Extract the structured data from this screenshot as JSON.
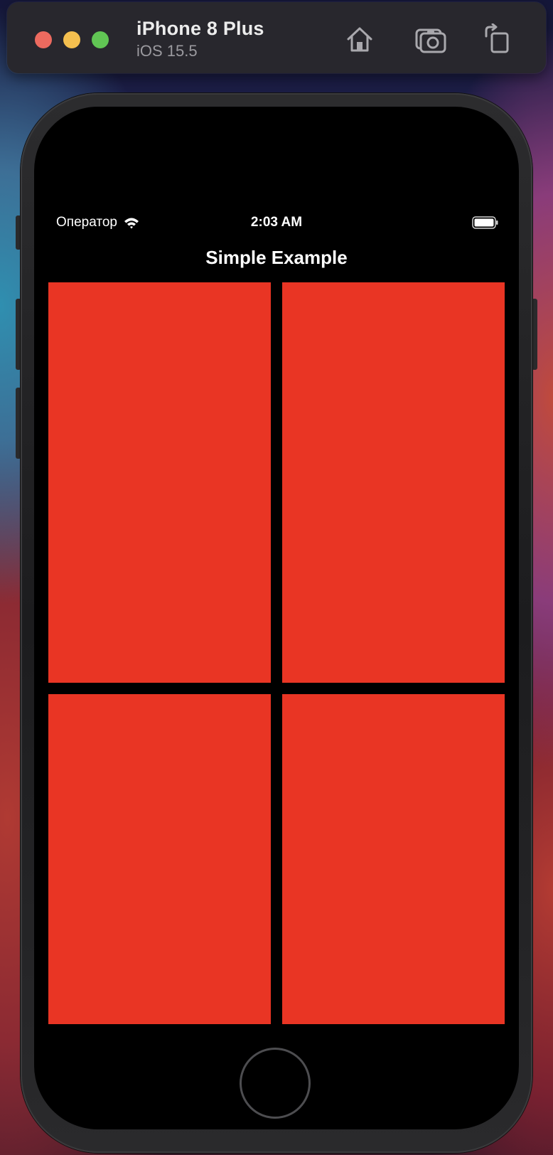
{
  "simulator": {
    "device_name": "iPhone 8 Plus",
    "os_version": "iOS 15.5",
    "toolbar": {
      "home_icon": "home-icon",
      "screenshot_icon": "camera-icon",
      "rotate_icon": "rotate-icon"
    },
    "traffic_lights": {
      "close_color": "#ec6a5f",
      "minimize_color": "#f4bf4f",
      "zoom_color": "#61c554"
    }
  },
  "status_bar": {
    "carrier": "Оператор",
    "time": "2:03 AM",
    "wifi_icon": "wifi-icon",
    "battery_icon": "battery-icon"
  },
  "app": {
    "title": "Simple Example",
    "tile_color": "#e93524",
    "tiles": 4
  }
}
